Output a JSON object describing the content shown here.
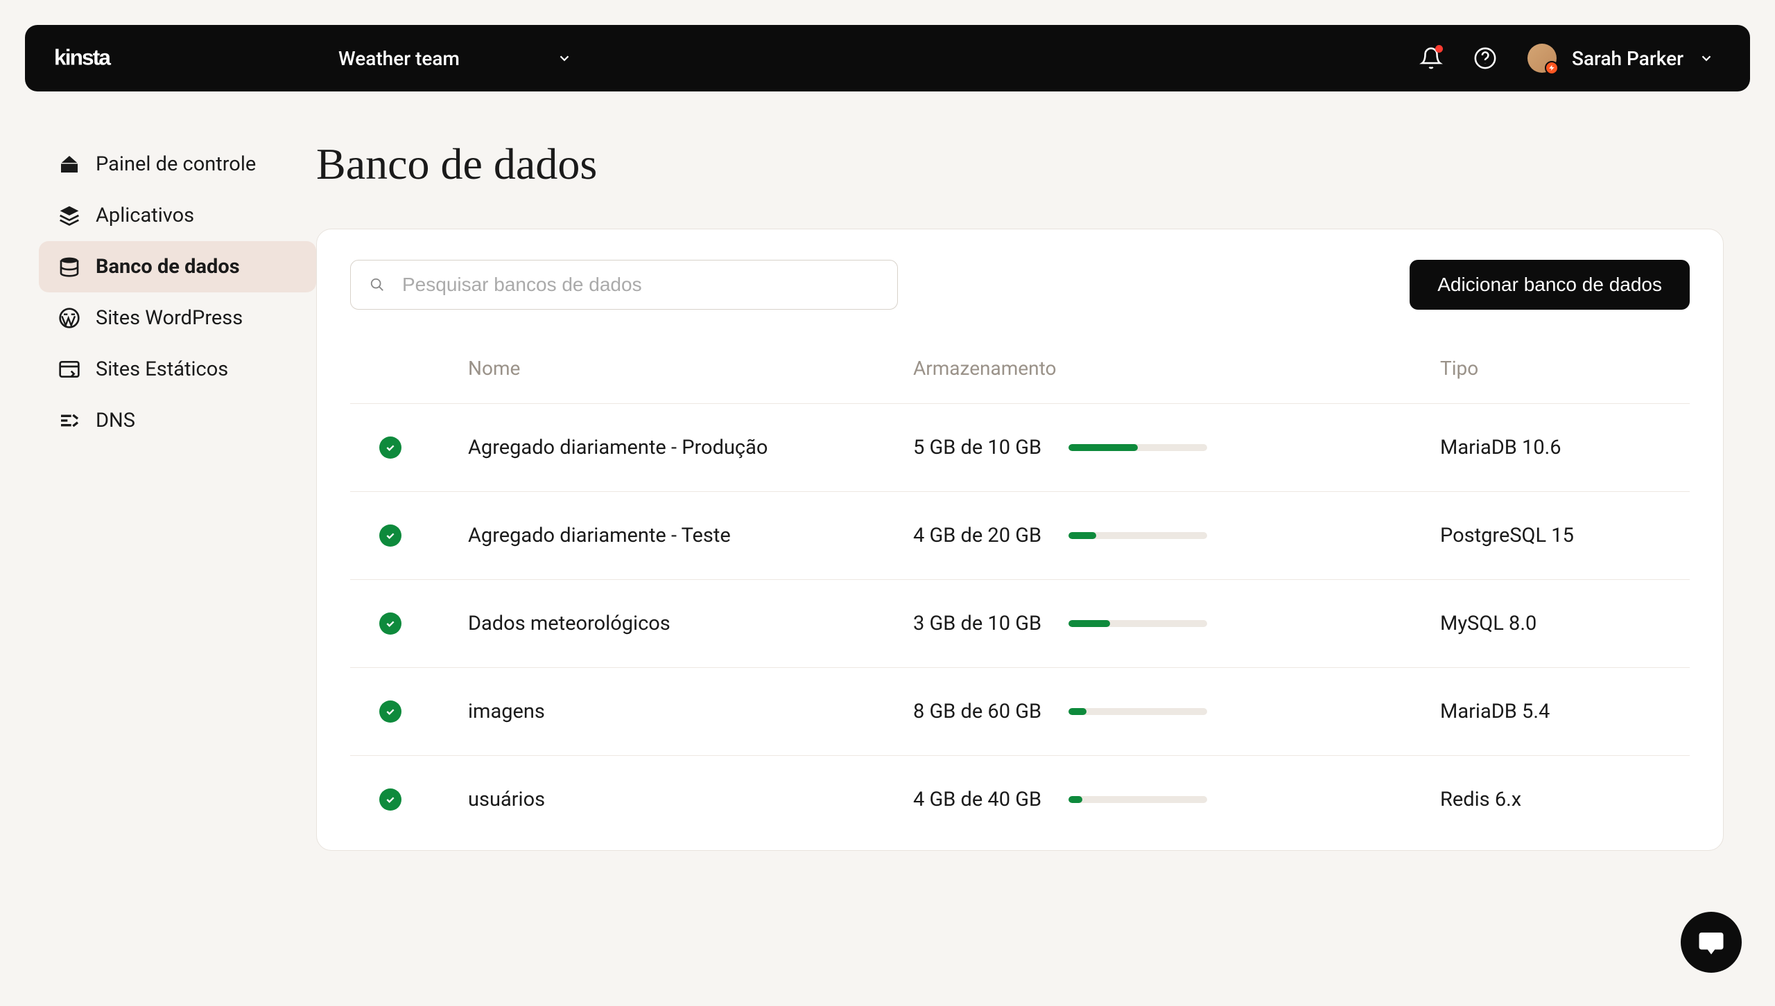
{
  "header": {
    "team_name": "Weather team",
    "user_name": "Sarah Parker"
  },
  "sidebar": {
    "items": [
      {
        "label": "Painel de controle"
      },
      {
        "label": "Aplicativos"
      },
      {
        "label": "Banco de dados"
      },
      {
        "label": "Sites WordPress"
      },
      {
        "label": "Sites Estáticos"
      },
      {
        "label": "DNS"
      }
    ],
    "active_index": 2
  },
  "page": {
    "title": "Banco de dados",
    "search_placeholder": "Pesquisar bancos de dados",
    "add_button": "Adicionar banco de dados"
  },
  "table": {
    "columns": {
      "name": "Nome",
      "storage": "Armazenamento",
      "type": "Tipo"
    },
    "rows": [
      {
        "name": "Agregado diariamente - Produção",
        "storage_text": "5 GB de 10 GB",
        "percent": 50,
        "type": "MariaDB 10.6"
      },
      {
        "name": "Agregado diariamente - Teste",
        "storage_text": "4 GB de 20 GB",
        "percent": 20,
        "type": "PostgreSQL 15"
      },
      {
        "name": "Dados meteorológicos",
        "storage_text": "3 GB de 10 GB",
        "percent": 30,
        "type": "MySQL 8.0"
      },
      {
        "name": "imagens",
        "storage_text": "8 GB de 60 GB",
        "percent": 13,
        "type": "MariaDB 5.4"
      },
      {
        "name": "usuários",
        "storage_text": "4 GB de 40 GB",
        "percent": 10,
        "type": "Redis 6.x"
      }
    ]
  }
}
